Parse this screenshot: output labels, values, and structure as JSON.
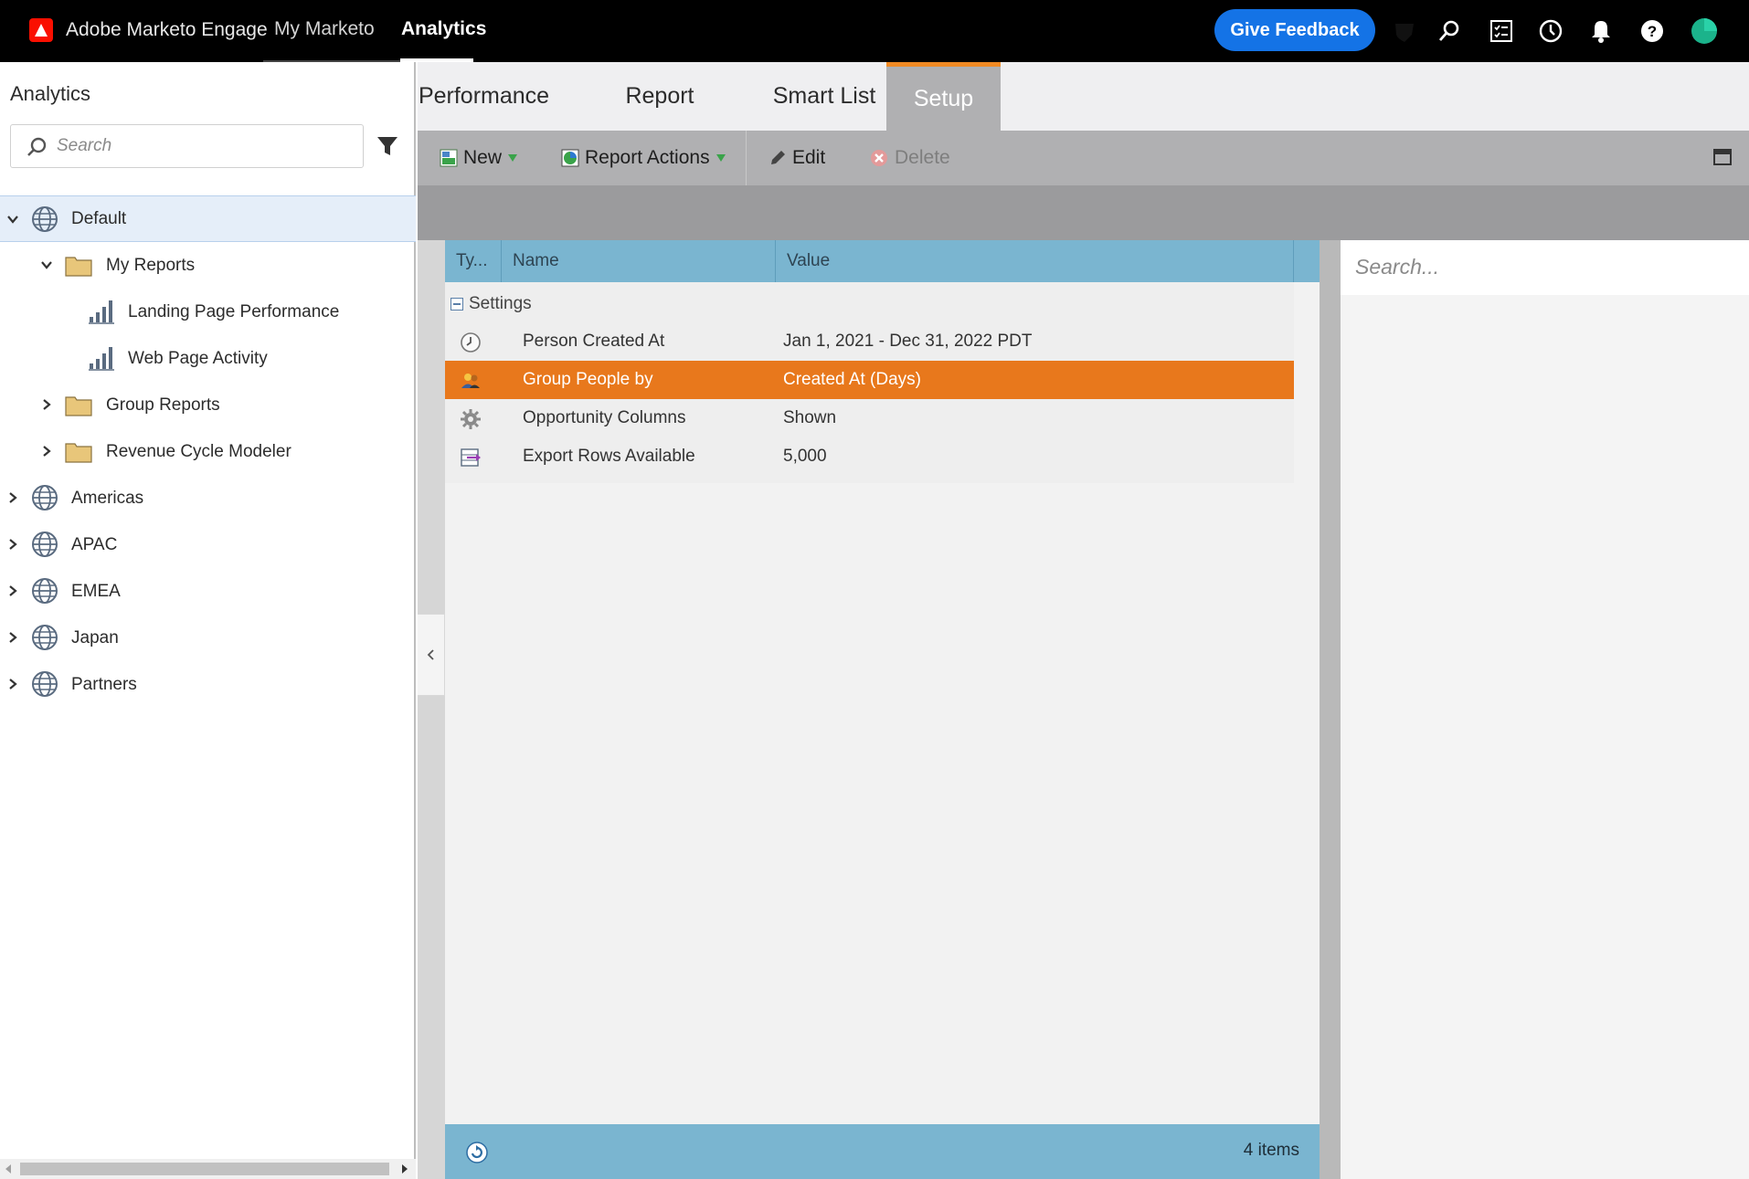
{
  "topnav": {
    "brand": "Adobe Marketo Engage",
    "links": [
      "My Marketo",
      "Analytics"
    ],
    "active_link": "Analytics",
    "feedback_label": "Give Feedback",
    "icons": [
      "shield-icon",
      "search-icon",
      "checklist-icon",
      "history-icon",
      "bell-icon",
      "help-icon",
      "avatar"
    ]
  },
  "sidebar": {
    "title": "Analytics",
    "search_placeholder": "Search",
    "tree": [
      {
        "label": "Default",
        "type": "workspace",
        "expanded": true,
        "selected": true
      },
      {
        "label": "My Reports",
        "type": "folder",
        "expanded": true
      },
      {
        "label": "Landing Page Performance",
        "type": "report"
      },
      {
        "label": "Web Page Activity",
        "type": "report"
      },
      {
        "label": "Group Reports",
        "type": "folder",
        "expanded": false
      },
      {
        "label": "Revenue Cycle Modeler",
        "type": "folder",
        "expanded": false
      },
      {
        "label": "Americas",
        "type": "workspace",
        "expanded": false
      },
      {
        "label": "APAC",
        "type": "workspace",
        "expanded": false
      },
      {
        "label": "EMEA",
        "type": "workspace",
        "expanded": false
      },
      {
        "label": "Japan",
        "type": "workspace",
        "expanded": false
      },
      {
        "label": "Partners",
        "type": "workspace",
        "expanded": false
      }
    ]
  },
  "tabs": [
    "Performance",
    "Report",
    "Smart List",
    "Setup"
  ],
  "active_tab": "Setup",
  "toolbar": {
    "new_label": "New",
    "report_actions_label": "Report Actions",
    "edit_label": "Edit",
    "delete_label": "Delete"
  },
  "grid": {
    "columns": [
      "Ty...",
      "Name",
      "Value"
    ],
    "group": "Settings",
    "rows": [
      {
        "icon": "clock-icon",
        "name": "Person Created At",
        "value": "Jan 1, 2021 - Dec 31, 2022 PDT"
      },
      {
        "icon": "people-icon",
        "name": "Group People by",
        "value": "Created At (Days)",
        "selected": true
      },
      {
        "icon": "gear-icon",
        "name": "Opportunity Columns",
        "value": "Shown"
      },
      {
        "icon": "export-icon",
        "name": "Export Rows Available",
        "value": "5,000"
      }
    ],
    "footer_count": "4 items"
  },
  "right_panel": {
    "search_placeholder": "Search..."
  },
  "colors": {
    "accent_blue": "#1473e6",
    "highlight_orange": "#e8781c",
    "grid_header": "#7ab5d0"
  }
}
